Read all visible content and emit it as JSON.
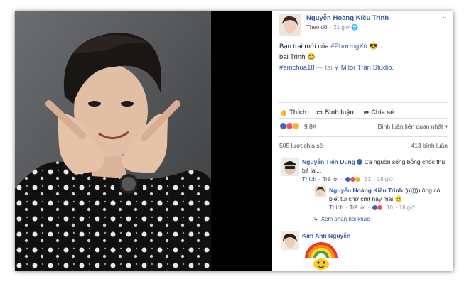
{
  "post": {
    "author": "Nguyễn Hoàng Kiều Trinh",
    "follow": "Theo dõi",
    "separator": "·",
    "time": "21 giờ",
    "globe": "🌐",
    "text_line1": "Bạn trai mới của",
    "hashtag1": "#PhươngXù",
    "emoji1": "😎",
    "text_line2": "bai Trinh",
    "emoji2": "😂",
    "hashtag2": "#emchua18",
    "location_prefix": "— tại",
    "location": "Milor Trần Studio."
  },
  "actions": {
    "like": "Thích",
    "comment": "Bình luận",
    "share": "Chia sẻ"
  },
  "stats": {
    "reactions_count": "9,8K",
    "sort_label": "Bình luận liên quan nhất",
    "shares": "505 lượt chia sẻ",
    "comments": "413 bình luận"
  },
  "comments": [
    {
      "name": "Nguyễn Tiến Dũng",
      "text": "Cả nguồn sống bỗng chốc thu bé lại...",
      "like": "Thích",
      "reply": "Trả lời",
      "reactions": "51",
      "time": "18 giờ"
    },
    {
      "name": "Nguyễn Hoàng Kiều Trinh",
      "text": ":))))))) ông có biết tui chờ cmt này mãi",
      "emoji": "😉",
      "like": "Thích",
      "reply": "Trả lời",
      "reactions": "10",
      "time": "18 giờ"
    },
    {
      "name": "Kim Anh Nguyễn"
    }
  ],
  "more_replies": "Xem phản hồi khác",
  "colors": {
    "link": "#365899",
    "muted": "#90949c",
    "like_blue": "#4267b2",
    "love_red": "#f25268",
    "haha_yellow": "#f7b125"
  }
}
